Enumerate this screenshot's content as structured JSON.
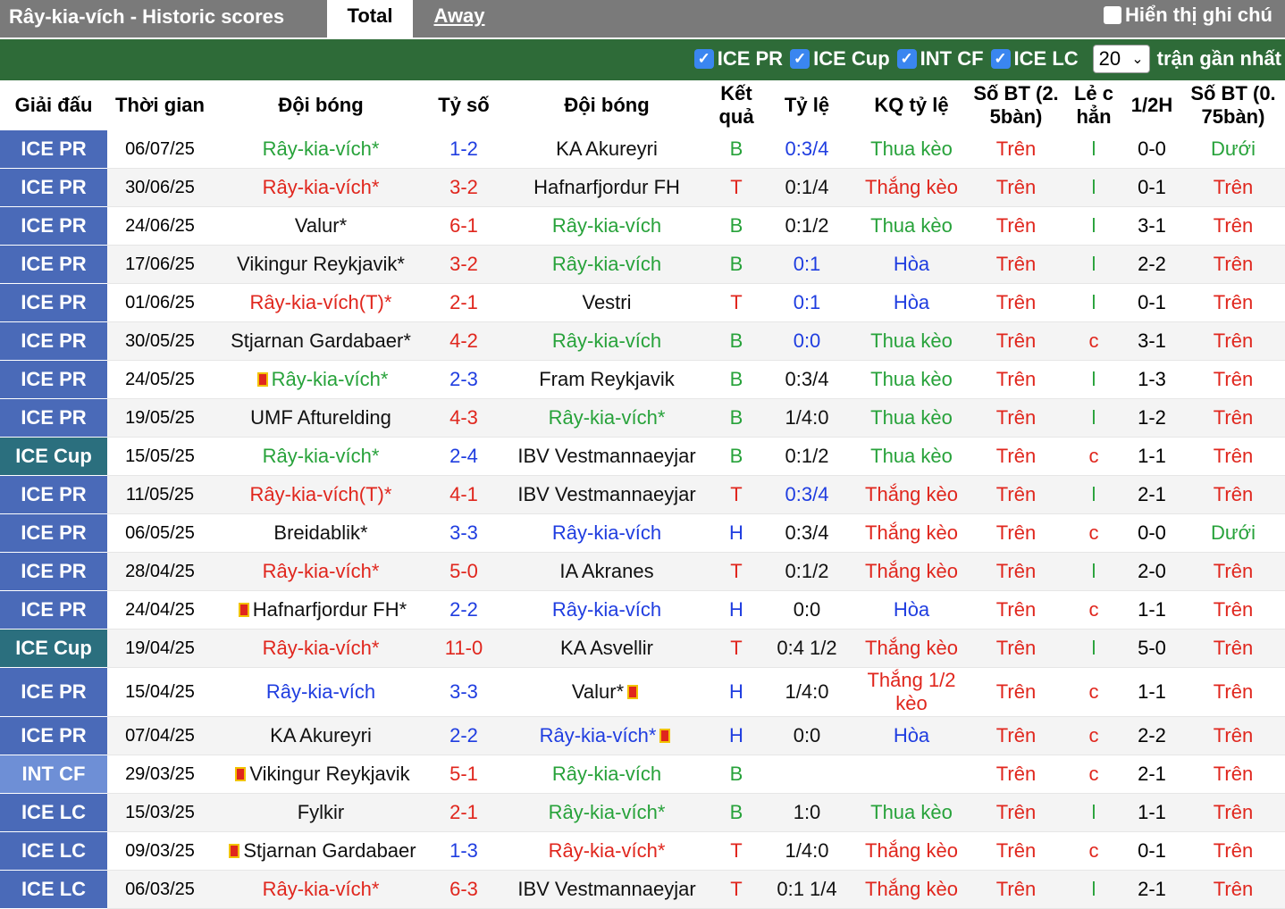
{
  "header": {
    "title": "Rây-kia-vích - Historic scores",
    "tab_total": "Total",
    "tab_away": "Away",
    "notes_label": "Hiển thị ghi chú"
  },
  "filters": {
    "items": [
      "ICE PR",
      "ICE Cup",
      "INT CF",
      "ICE LC"
    ],
    "count_value": "20",
    "count_suffix": "trận gần nhất"
  },
  "columns": [
    "Giải đấu",
    "Thời gian",
    "Đội bóng",
    "Tỷ số",
    "Đội bóng",
    "Kết quả",
    "Tỷ lệ",
    "KQ tỷ lệ",
    "Số BT (2. 5bàn)",
    "Lẻ c hẳn",
    "1/2H",
    "Số BT (0. 75bàn)"
  ],
  "colors": {
    "league_pr": "#4a6ab8",
    "league_cup": "#2b6f7e",
    "league_intcf": "#6e8fd6",
    "league_lc": "#4a6ab8"
  },
  "rows": [
    {
      "league": "ICE PR",
      "date": "06/07/25",
      "home": "Rây-kia-vích*",
      "home_c": "green",
      "score": "1-2",
      "score_c": "blue",
      "away": "KA Akureyri",
      "away_c": "black",
      "res": "B",
      "res_c": "green",
      "odds": "0:3/4",
      "odds_c": "blue",
      "kq": "Thua kèo",
      "kq_c": "green",
      "bt": "Trên",
      "bt_c": "red",
      "lc": "l",
      "lc_c": "green",
      "h": "0-0",
      "bt2": "Dưới",
      "bt2_c": "green"
    },
    {
      "league": "ICE PR",
      "date": "30/06/25",
      "home": "Rây-kia-vích*",
      "home_c": "red",
      "score": "3-2",
      "score_c": "red",
      "away": "Hafnarfjordur FH",
      "away_c": "black",
      "res": "T",
      "res_c": "red",
      "odds": "0:1/4",
      "odds_c": "black",
      "kq": "Thắng kèo",
      "kq_c": "red",
      "bt": "Trên",
      "bt_c": "red",
      "lc": "l",
      "lc_c": "green",
      "h": "0-1",
      "bt2": "Trên",
      "bt2_c": "red"
    },
    {
      "league": "ICE PR",
      "date": "24/06/25",
      "home": "Valur*",
      "home_c": "black",
      "score": "6-1",
      "score_c": "red",
      "away": "Rây-kia-vích",
      "away_c": "green",
      "res": "B",
      "res_c": "green",
      "odds": "0:1/2",
      "odds_c": "black",
      "kq": "Thua kèo",
      "kq_c": "green",
      "bt": "Trên",
      "bt_c": "red",
      "lc": "l",
      "lc_c": "green",
      "h": "3-1",
      "bt2": "Trên",
      "bt2_c": "red"
    },
    {
      "league": "ICE PR",
      "date": "17/06/25",
      "home": "Vikingur Reykjavik*",
      "home_c": "black",
      "score": "3-2",
      "score_c": "red",
      "away": "Rây-kia-vích",
      "away_c": "green",
      "res": "B",
      "res_c": "green",
      "odds": "0:1",
      "odds_c": "blue",
      "kq": "Hòa",
      "kq_c": "blue",
      "bt": "Trên",
      "bt_c": "red",
      "lc": "l",
      "lc_c": "green",
      "h": "2-2",
      "bt2": "Trên",
      "bt2_c": "red"
    },
    {
      "league": "ICE PR",
      "date": "01/06/25",
      "home": "Rây-kia-vích(T)*",
      "home_c": "red",
      "score": "2-1",
      "score_c": "red",
      "away": "Vestri",
      "away_c": "black",
      "res": "T",
      "res_c": "red",
      "odds": "0:1",
      "odds_c": "blue",
      "kq": "Hòa",
      "kq_c": "blue",
      "bt": "Trên",
      "bt_c": "red",
      "lc": "l",
      "lc_c": "green",
      "h": "0-1",
      "bt2": "Trên",
      "bt2_c": "red"
    },
    {
      "league": "ICE PR",
      "date": "30/05/25",
      "home": "Stjarnan Gardabaer*",
      "home_c": "black",
      "score": "4-2",
      "score_c": "red",
      "away": "Rây-kia-vích",
      "away_c": "green",
      "res": "B",
      "res_c": "green",
      "odds": "0:0",
      "odds_c": "blue",
      "kq": "Thua kèo",
      "kq_c": "green",
      "bt": "Trên",
      "bt_c": "red",
      "lc": "c",
      "lc_c": "red",
      "h": "3-1",
      "bt2": "Trên",
      "bt2_c": "red"
    },
    {
      "league": "ICE PR",
      "date": "24/05/25",
      "home": "Rây-kia-vích*",
      "home_c": "green",
      "home_card": true,
      "score": "2-3",
      "score_c": "blue",
      "away": "Fram Reykjavik",
      "away_c": "black",
      "res": "B",
      "res_c": "green",
      "odds": "0:3/4",
      "odds_c": "black",
      "kq": "Thua kèo",
      "kq_c": "green",
      "bt": "Trên",
      "bt_c": "red",
      "lc": "l",
      "lc_c": "green",
      "h": "1-3",
      "bt2": "Trên",
      "bt2_c": "red"
    },
    {
      "league": "ICE PR",
      "date": "19/05/25",
      "home": "UMF Afturelding",
      "home_c": "black",
      "score": "4-3",
      "score_c": "red",
      "away": "Rây-kia-vích*",
      "away_c": "green",
      "res": "B",
      "res_c": "green",
      "odds": "1/4:0",
      "odds_c": "black",
      "kq": "Thua kèo",
      "kq_c": "green",
      "bt": "Trên",
      "bt_c": "red",
      "lc": "l",
      "lc_c": "green",
      "h": "1-2",
      "bt2": "Trên",
      "bt2_c": "red"
    },
    {
      "league": "ICE Cup",
      "date": "15/05/25",
      "home": "Rây-kia-vích*",
      "home_c": "green",
      "score": "2-4",
      "score_c": "blue",
      "away": "IBV Vestmannaeyjar",
      "away_c": "black",
      "res": "B",
      "res_c": "green",
      "odds": "0:1/2",
      "odds_c": "black",
      "kq": "Thua kèo",
      "kq_c": "green",
      "bt": "Trên",
      "bt_c": "red",
      "lc": "c",
      "lc_c": "red",
      "h": "1-1",
      "bt2": "Trên",
      "bt2_c": "red"
    },
    {
      "league": "ICE PR",
      "date": "11/05/25",
      "home": "Rây-kia-vích(T)*",
      "home_c": "red",
      "score": "4-1",
      "score_c": "red",
      "away": "IBV Vestmannaeyjar",
      "away_c": "black",
      "res": "T",
      "res_c": "red",
      "odds": "0:3/4",
      "odds_c": "blue",
      "kq": "Thắng kèo",
      "kq_c": "red",
      "bt": "Trên",
      "bt_c": "red",
      "lc": "l",
      "lc_c": "green",
      "h": "2-1",
      "bt2": "Trên",
      "bt2_c": "red"
    },
    {
      "league": "ICE PR",
      "date": "06/05/25",
      "home": "Breidablik*",
      "home_c": "black",
      "score": "3-3",
      "score_c": "blue",
      "away": "Rây-kia-vích",
      "away_c": "blue",
      "res": "H",
      "res_c": "blue",
      "odds": "0:3/4",
      "odds_c": "black",
      "kq": "Thắng kèo",
      "kq_c": "red",
      "bt": "Trên",
      "bt_c": "red",
      "lc": "c",
      "lc_c": "red",
      "h": "0-0",
      "bt2": "Dưới",
      "bt2_c": "green"
    },
    {
      "league": "ICE PR",
      "date": "28/04/25",
      "home": "Rây-kia-vích*",
      "home_c": "red",
      "score": "5-0",
      "score_c": "red",
      "away": "IA Akranes",
      "away_c": "black",
      "res": "T",
      "res_c": "red",
      "odds": "0:1/2",
      "odds_c": "black",
      "kq": "Thắng kèo",
      "kq_c": "red",
      "bt": "Trên",
      "bt_c": "red",
      "lc": "l",
      "lc_c": "green",
      "h": "2-0",
      "bt2": "Trên",
      "bt2_c": "red"
    },
    {
      "league": "ICE PR",
      "date": "24/04/25",
      "home": "Hafnarfjordur FH*",
      "home_c": "black",
      "home_card": true,
      "score": "2-2",
      "score_c": "blue",
      "away": "Rây-kia-vích",
      "away_c": "blue",
      "res": "H",
      "res_c": "blue",
      "odds": "0:0",
      "odds_c": "black",
      "kq": "Hòa",
      "kq_c": "blue",
      "bt": "Trên",
      "bt_c": "red",
      "lc": "c",
      "lc_c": "red",
      "h": "1-1",
      "bt2": "Trên",
      "bt2_c": "red"
    },
    {
      "league": "ICE Cup",
      "date": "19/04/25",
      "home": "Rây-kia-vích*",
      "home_c": "red",
      "score": "11-0",
      "score_c": "red",
      "away": "KA Asvellir",
      "away_c": "black",
      "res": "T",
      "res_c": "red",
      "odds": "0:4 1/2",
      "odds_c": "black",
      "kq": "Thắng kèo",
      "kq_c": "red",
      "bt": "Trên",
      "bt_c": "red",
      "lc": "l",
      "lc_c": "green",
      "h": "5-0",
      "bt2": "Trên",
      "bt2_c": "red"
    },
    {
      "league": "ICE PR",
      "date": "15/04/25",
      "home": "Rây-kia-vích",
      "home_c": "blue",
      "score": "3-3",
      "score_c": "blue",
      "away": "Valur*",
      "away_c": "black",
      "away_card": true,
      "res": "H",
      "res_c": "blue",
      "odds": "1/4:0",
      "odds_c": "black",
      "kq": "Thắng 1/2 kèo",
      "kq_c": "red",
      "bt": "Trên",
      "bt_c": "red",
      "lc": "c",
      "lc_c": "red",
      "h": "1-1",
      "bt2": "Trên",
      "bt2_c": "red",
      "tall": true
    },
    {
      "league": "ICE PR",
      "date": "07/04/25",
      "home": "KA Akureyri",
      "home_c": "black",
      "score": "2-2",
      "score_c": "blue",
      "away": "Rây-kia-vích*",
      "away_c": "blue",
      "away_card": true,
      "res": "H",
      "res_c": "blue",
      "odds": "0:0",
      "odds_c": "black",
      "kq": "Hòa",
      "kq_c": "blue",
      "bt": "Trên",
      "bt_c": "red",
      "lc": "c",
      "lc_c": "red",
      "h": "2-2",
      "bt2": "Trên",
      "bt2_c": "red"
    },
    {
      "league": "INT CF",
      "date": "29/03/25",
      "home": "Vikingur Reykjavik",
      "home_c": "black",
      "home_card": true,
      "score": "5-1",
      "score_c": "red",
      "away": "Rây-kia-vích",
      "away_c": "green",
      "res": "B",
      "res_c": "green",
      "odds": "",
      "odds_c": "black",
      "kq": "",
      "kq_c": "black",
      "bt": "Trên",
      "bt_c": "red",
      "lc": "c",
      "lc_c": "red",
      "h": "2-1",
      "bt2": "Trên",
      "bt2_c": "red"
    },
    {
      "league": "ICE LC",
      "date": "15/03/25",
      "home": "Fylkir",
      "home_c": "black",
      "score": "2-1",
      "score_c": "red",
      "away": "Rây-kia-vích*",
      "away_c": "green",
      "res": "B",
      "res_c": "green",
      "odds": "1:0",
      "odds_c": "black",
      "kq": "Thua kèo",
      "kq_c": "green",
      "bt": "Trên",
      "bt_c": "red",
      "lc": "l",
      "lc_c": "green",
      "h": "1-1",
      "bt2": "Trên",
      "bt2_c": "red"
    },
    {
      "league": "ICE LC",
      "date": "09/03/25",
      "home": "Stjarnan Gardabaer",
      "home_c": "black",
      "home_card": true,
      "score": "1-3",
      "score_c": "blue",
      "away": "Rây-kia-vích*",
      "away_c": "red",
      "res": "T",
      "res_c": "red",
      "odds": "1/4:0",
      "odds_c": "black",
      "kq": "Thắng kèo",
      "kq_c": "red",
      "bt": "Trên",
      "bt_c": "red",
      "lc": "c",
      "lc_c": "red",
      "h": "0-1",
      "bt2": "Trên",
      "bt2_c": "red"
    },
    {
      "league": "ICE LC",
      "date": "06/03/25",
      "home": "Rây-kia-vích*",
      "home_c": "red",
      "score": "6-3",
      "score_c": "red",
      "away": "IBV Vestmannaeyjar",
      "away_c": "black",
      "res": "T",
      "res_c": "red",
      "odds": "0:1 1/4",
      "odds_c": "black",
      "kq": "Thắng kèo",
      "kq_c": "red",
      "bt": "Trên",
      "bt_c": "red",
      "lc": "l",
      "lc_c": "green",
      "h": "2-1",
      "bt2": "Trên",
      "bt2_c": "red"
    }
  ]
}
